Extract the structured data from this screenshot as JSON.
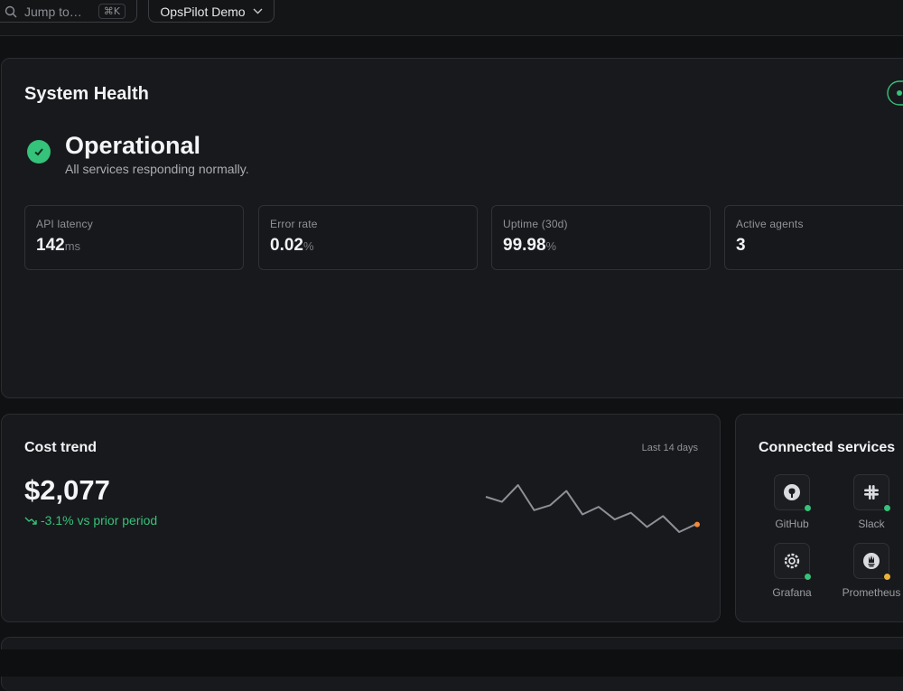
{
  "topbar": {
    "search_placeholder": "Jump to…",
    "search_shortcut": "⌘K",
    "workspace_name": "OpsPilot Demo"
  },
  "health": {
    "title": "System Health",
    "status": "Operational",
    "status_detail": "All services responding normally.",
    "metrics": [
      {
        "label": "API latency",
        "value": "142",
        "unit": "ms"
      },
      {
        "label": "Error rate",
        "value": "0.02",
        "unit": "%"
      },
      {
        "label": "Uptime (30d)",
        "value": "99.98",
        "unit": "%"
      },
      {
        "label": "Active agents",
        "value": "3",
        "unit": ""
      }
    ]
  },
  "cost": {
    "title": "Cost trend",
    "period": "Last 14 days",
    "amount": "$2,077",
    "delta": "-3.1% vs prior period",
    "trend": [
      163,
      157,
      177,
      147,
      153,
      170,
      142,
      151,
      136,
      144,
      127,
      140,
      121,
      130
    ]
  },
  "services": {
    "title": "Connected services",
    "items": [
      {
        "name": "GitHub",
        "icon": "github-icon",
        "status_color": "#35c27a"
      },
      {
        "name": "Slack",
        "icon": "slack-icon",
        "status_color": "#35c27a"
      },
      {
        "name": "Grafana",
        "icon": "grafana-icon",
        "status_color": "#35c27a"
      },
      {
        "name": "Prometheus",
        "icon": "prometheus-icon",
        "status_color": "#e8b339"
      }
    ]
  },
  "colors": {
    "accent_green": "#35c27a",
    "warning_yellow": "#e8b339",
    "spark_end": "#f08a3c"
  }
}
